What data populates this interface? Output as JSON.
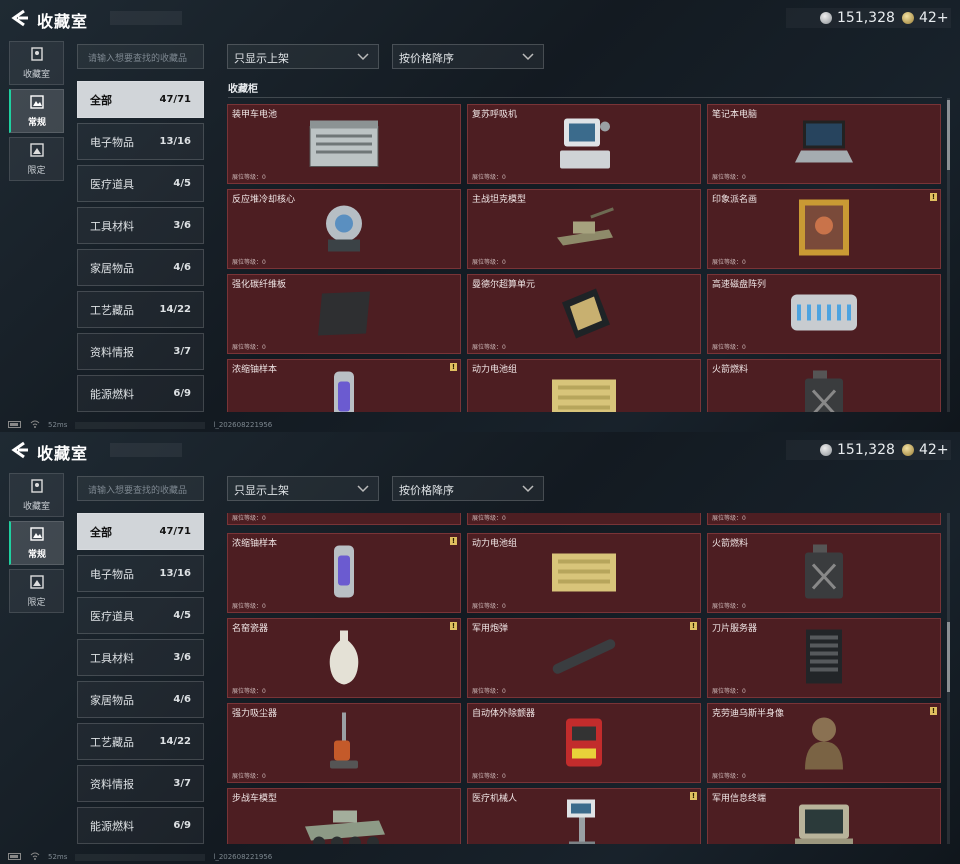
{
  "header": {
    "back_icon": "back-arrow-icon",
    "title": "收藏室"
  },
  "currency": {
    "silver": "151,328",
    "gold": "42+"
  },
  "sidenav": [
    {
      "label": "收藏室",
      "icon": "vault-icon",
      "active": false
    },
    {
      "label": "常规",
      "icon": "picture-icon",
      "active": true
    },
    {
      "label": "限定",
      "icon": "limited-icon",
      "active": false
    }
  ],
  "search": {
    "placeholder": "请输入想要查找的收藏品"
  },
  "filters": {
    "show": "只显示上架",
    "sort": "按价格降序"
  },
  "categories": [
    {
      "label": "全部",
      "count": "47/71"
    },
    {
      "label": "电子物品",
      "count": "13/16"
    },
    {
      "label": "医疗道具",
      "count": "4/5"
    },
    {
      "label": "工具材料",
      "count": "3/6"
    },
    {
      "label": "家居物品",
      "count": "4/6"
    },
    {
      "label": "工艺藏品",
      "count": "14/22"
    },
    {
      "label": "资料情报",
      "count": "3/7"
    },
    {
      "label": "能源燃料",
      "count": "6/9"
    }
  ],
  "section": {
    "title": "收藏柜"
  },
  "level_label": "展位等级：0",
  "items": [
    {
      "name": "装甲车电池",
      "flag": false,
      "icon": "battery-icon"
    },
    {
      "name": "复苏呼吸机",
      "flag": false,
      "icon": "ventilator-icon"
    },
    {
      "name": "笔记本电脑",
      "flag": false,
      "icon": "laptop-icon"
    },
    {
      "name": "反应堆冷却核心",
      "flag": false,
      "icon": "reactor-core-icon"
    },
    {
      "name": "主战坦克模型",
      "flag": false,
      "icon": "tank-icon"
    },
    {
      "name": "印象派名画",
      "flag": true,
      "icon": "painting-icon"
    },
    {
      "name": "强化碳纤维板",
      "flag": false,
      "icon": "carbon-plate-icon"
    },
    {
      "name": "曼德尔超算单元",
      "flag": false,
      "icon": "compute-unit-icon"
    },
    {
      "name": "高速磁盘阵列",
      "flag": false,
      "icon": "disk-array-icon"
    },
    {
      "name": "浓缩铀样本",
      "flag": true,
      "icon": "uranium-icon"
    },
    {
      "name": "动力电池组",
      "flag": false,
      "icon": "battery-pack-icon"
    },
    {
      "name": "火箭燃料",
      "flag": false,
      "icon": "fuel-can-icon"
    },
    {
      "name": "名窑瓷器",
      "flag": true,
      "icon": "vase-icon"
    },
    {
      "name": "军用炮弹",
      "flag": true,
      "icon": "shell-icon"
    },
    {
      "name": "刀片服务器",
      "flag": false,
      "icon": "server-icon"
    },
    {
      "name": "强力吸尘器",
      "flag": false,
      "icon": "vacuum-icon"
    },
    {
      "name": "自动体外除颤器",
      "flag": false,
      "icon": "defibrillator-icon"
    },
    {
      "name": "克劳迪乌斯半身像",
      "flag": true,
      "icon": "bust-icon"
    },
    {
      "name": "步战车模型",
      "flag": false,
      "icon": "ifv-icon"
    },
    {
      "name": "医疗机械人",
      "flag": true,
      "icon": "robot-icon"
    },
    {
      "name": "军用信息终端",
      "flag": false,
      "icon": "terminal-icon"
    }
  ],
  "status": {
    "ping": "52ms",
    "build": "l_202608221956"
  },
  "colors": {
    "card_bg": "#4d1e22",
    "accent": "#1fd0a0",
    "flag": "#e0c060"
  }
}
